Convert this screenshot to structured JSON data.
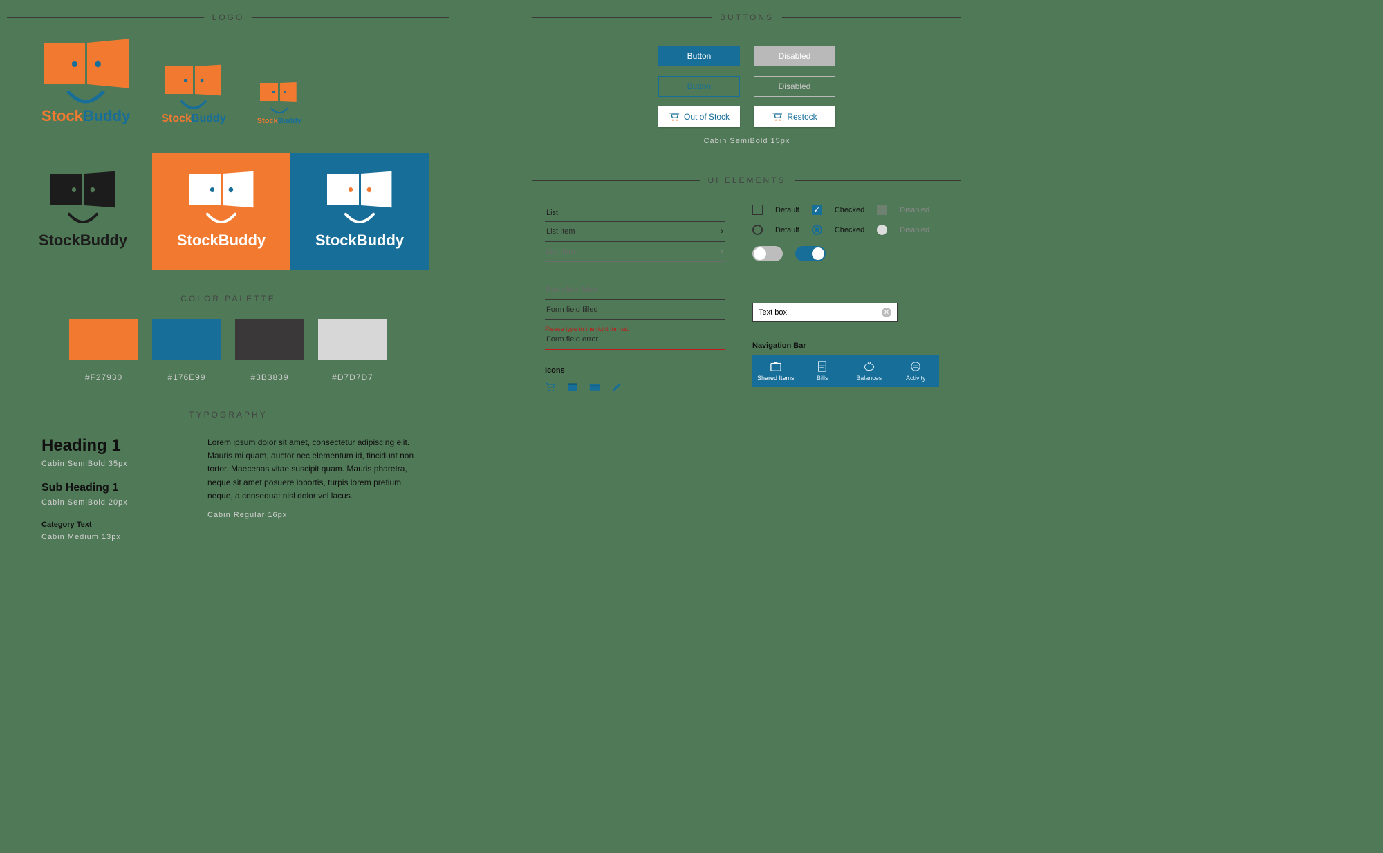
{
  "sections": {
    "logo": "LOGO",
    "palette": "COLOR PALETTE",
    "typography": "TYPOGRAPHY",
    "buttons": "BUTTONS",
    "ui_elements": "UI ELEMENTS"
  },
  "brand": {
    "part1": "Stock",
    "part2": "Buddy",
    "full": "StockBuddy"
  },
  "palette": [
    {
      "hex": "#F27930"
    },
    {
      "hex": "#176E99"
    },
    {
      "hex": "#3B3839"
    },
    {
      "hex": "#D7D7D7"
    }
  ],
  "typography": {
    "h1": "Heading 1",
    "h1_caption": "Cabin  SemiBold  35px",
    "sh1": "Sub Heading 1",
    "sh1_caption": "Cabin  SemiBold  20px",
    "cat": "Category Text",
    "cat_caption": "Cabin  Medium  13px",
    "body": "Lorem ipsum dolor sit amet, consectetur adipiscing elit. Mauris mi quam, auctor nec elementum id, tincidunt non tortor. Maecenas vitae suscipit quam. Mauris pharetra, neque sit amet posuere lobortis, turpis lorem pretium neque, a consequat nisl dolor vel lacus.",
    "body_caption": "Cabin  Regular  16px"
  },
  "buttons": {
    "primary": "Button",
    "disabled": "Disabled",
    "outline": "Button",
    "outline_disabled": "Disabled",
    "out_of_stock": "Out of Stock",
    "restock": "Restock",
    "caption": "Cabin  SemiBold  15px"
  },
  "ui": {
    "list_head": "List",
    "list_item": "List Item",
    "list_item_disabled": "List Item",
    "form_label": "Form field label",
    "form_filled": "Form field filled",
    "form_error_msg": "Please type in the right format.",
    "form_error": "Form field error",
    "icons_label": "Icons",
    "check_default": "Default",
    "check_checked": "Checked",
    "check_disabled": "Disabled",
    "radio_default": "Default",
    "radio_checked": "Checked",
    "radio_disabled": "Disabled",
    "textbox": "Text box.",
    "nav_label": "Navigation Bar",
    "nav": [
      "Shared Items",
      "Bills",
      "Balances",
      "Activity"
    ]
  }
}
